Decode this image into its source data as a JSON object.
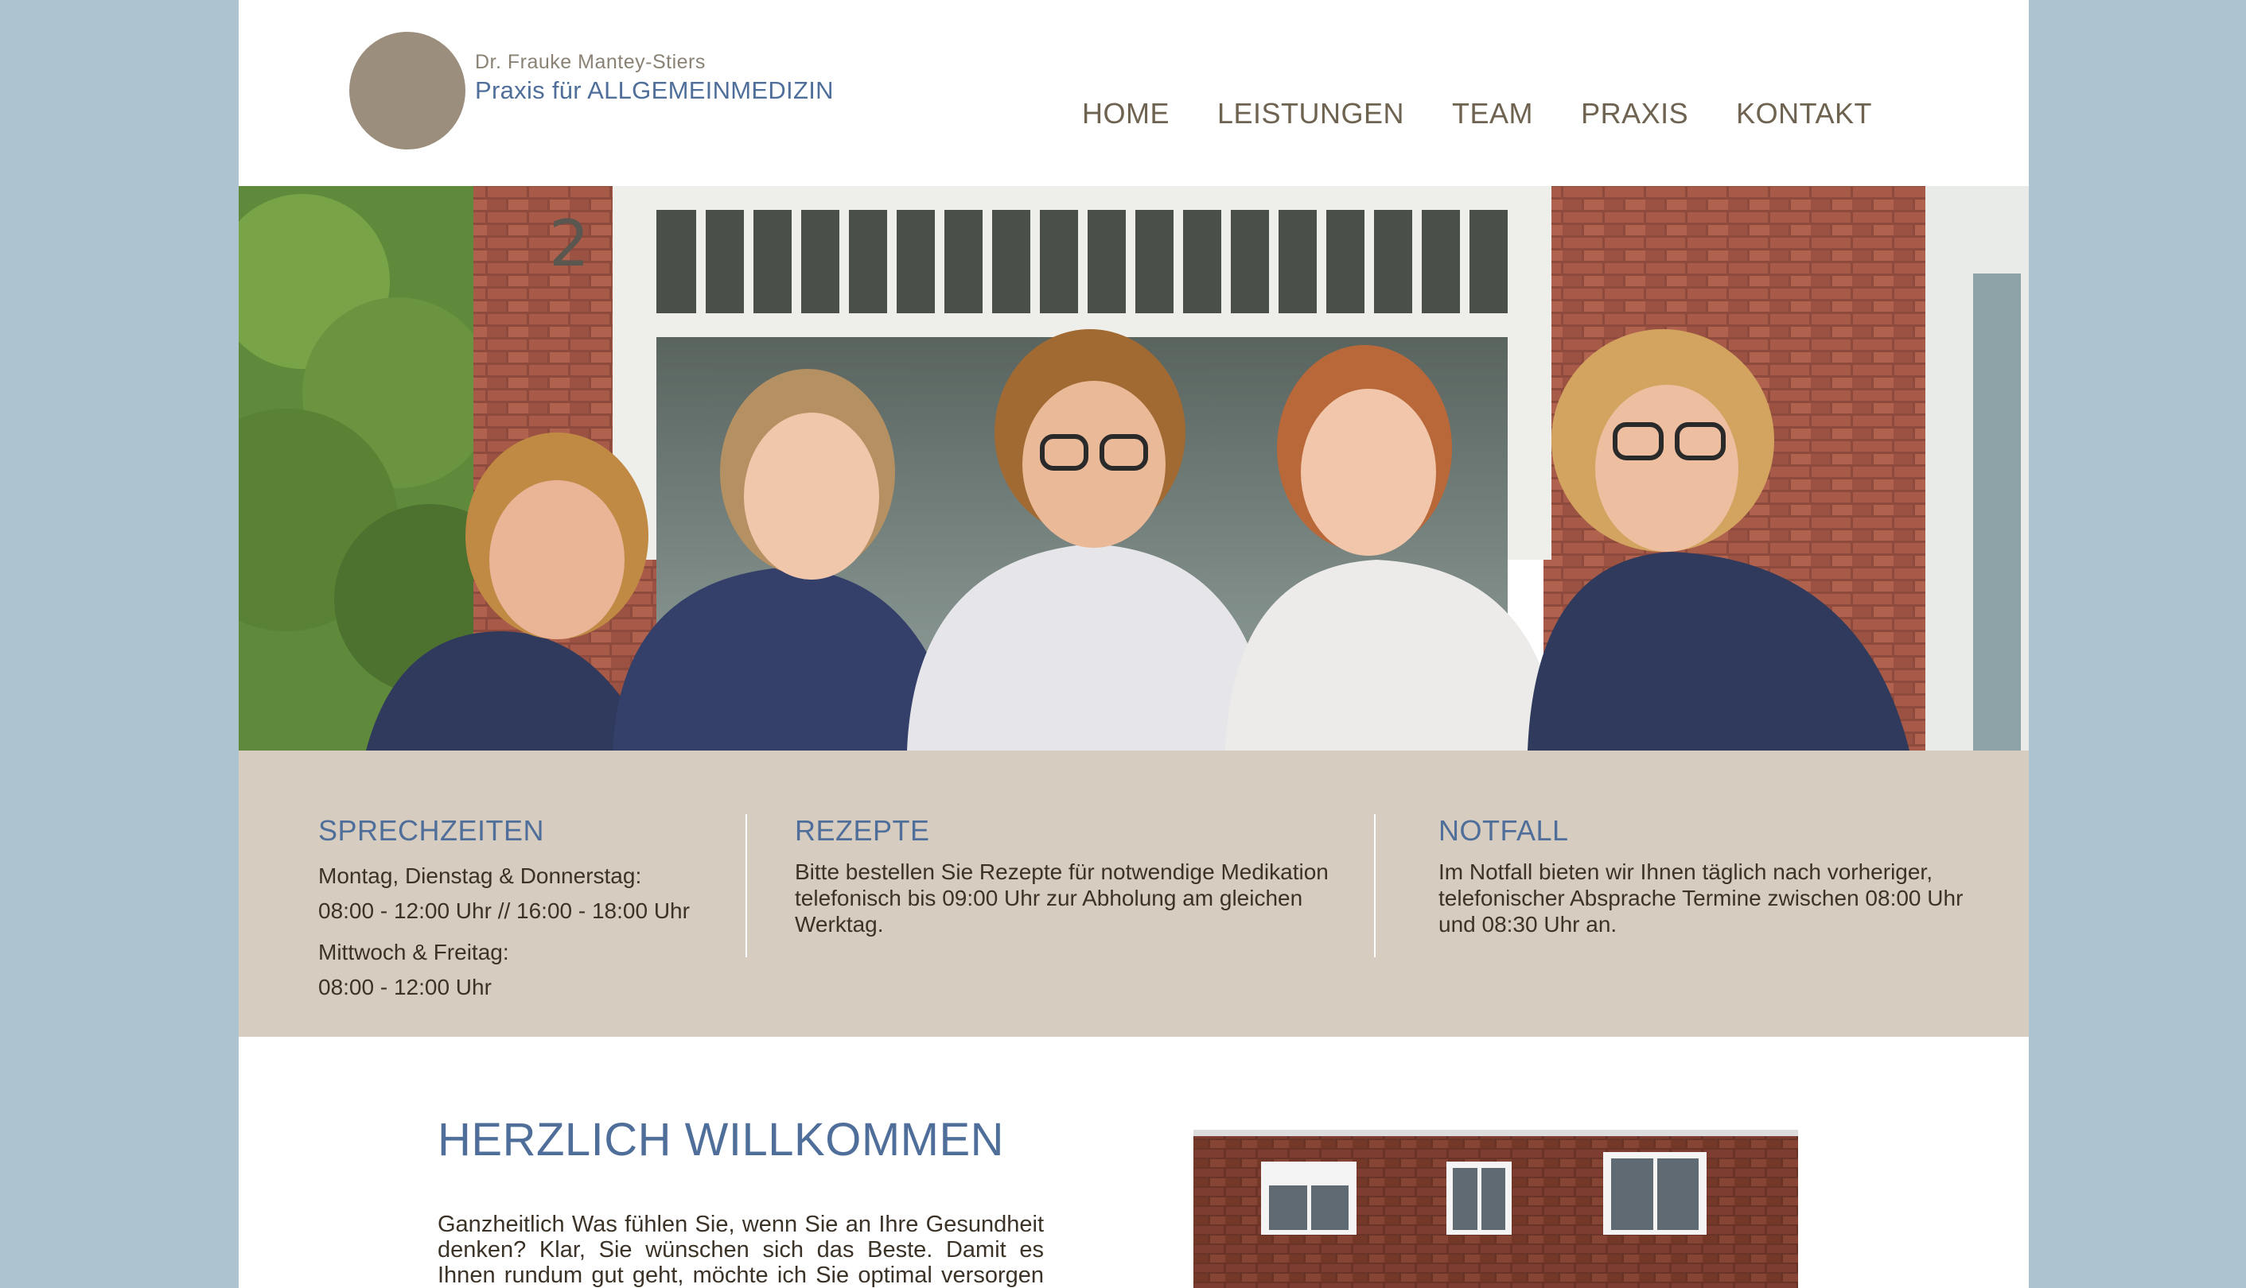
{
  "header": {
    "doctor_name": "Dr. Frauke Mantey-Stiers",
    "practice_name": "Praxis für ALLGEMEINMEDIZIN",
    "logo_color": "#9b8e7d",
    "nav": [
      {
        "label": "HOME"
      },
      {
        "label": "LEISTUNGEN"
      },
      {
        "label": "TEAM"
      },
      {
        "label": "PRAXIS"
      },
      {
        "label": "KONTAKT"
      }
    ]
  },
  "hero": {
    "image": "team-photo",
    "house_number": "2"
  },
  "info": {
    "sprechzeiten": {
      "title": "SPRECHZEITEN",
      "line1": "Montag, Dienstag & Donnerstag:",
      "line2": "08:00 - 12:00 Uhr // 16:00 - 18:00 Uhr",
      "line3": "Mittwoch & Freitag:",
      "line4": "08:00 - 12:00 Uhr"
    },
    "rezepte": {
      "title": "REZEPTE",
      "text": "Bitte bestellen Sie Rezepte für notwendige Medikation telefonisch bis 09:00 Uhr zur Abholung am gleichen Werktag."
    },
    "notfall": {
      "title": "NOTFALL",
      "text": "Im Notfall bieten wir Ihnen täglich nach vorheriger, telefonischer Absprache Termine zwischen 08:00 Uhr und 08:30 Uhr an."
    }
  },
  "welcome": {
    "title": "HERZLICH WILLKOMMEN",
    "text": "Ganzheitlich Was fühlen Sie, wenn Sie an Ihre Gesundheit denken? Klar, Sie wünschen sich das Beste. Damit es Ihnen rundum gut geht, möchte ich Sie optimal versorgen mit -"
  },
  "colors": {
    "accent_blue": "#4f6f9a",
    "nav_brown": "#6e6250",
    "info_bg": "#d6ccc0",
    "page_bg": "#adc3cf"
  }
}
